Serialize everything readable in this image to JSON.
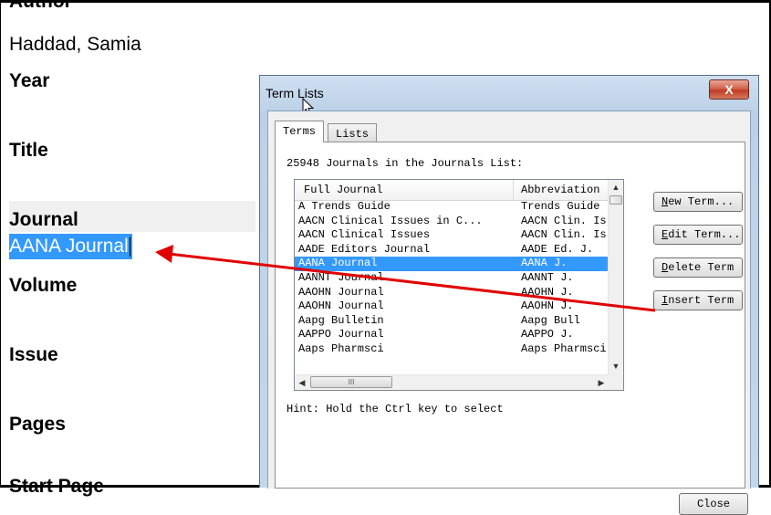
{
  "reference": {
    "author_label": "Author",
    "author_value": "Haddad, Samia",
    "year_label": "Year",
    "title_label": "Title",
    "journal_label": "Journal",
    "journal_value": "AANA Journal",
    "volume_label": "Volume",
    "issue_label": "Issue",
    "pages_label": "Pages",
    "start_page_label": "Start Page"
  },
  "dialog": {
    "title": "Term Lists",
    "close_x": "X",
    "tabs": [
      "Terms",
      "Lists"
    ],
    "count_text": "25948 Journals in the Journals List:",
    "columns": [
      "Full Journal",
      "Abbreviation"
    ],
    "rows": [
      {
        "full": "A Trends Guide",
        "abbr": "Trends Guide"
      },
      {
        "full": "AACN Clinical Issues in C...",
        "abbr": "AACN Clin. Is"
      },
      {
        "full": "AACN Clinical Issues",
        "abbr": "AACN Clin. Is"
      },
      {
        "full": "AADE Editors Journal",
        "abbr": "AADE Ed. J."
      },
      {
        "full": "AANA Journal",
        "abbr": "AANA J.",
        "selected": true
      },
      {
        "full": "AANNT Journal",
        "abbr": "AANNT J."
      },
      {
        "full": "AAOHN Journal",
        "abbr": "AAOHN J."
      },
      {
        "full": "AAOHN Journal",
        "abbr": "AAOHN J."
      },
      {
        "full": "Aapg Bulletin",
        "abbr": "Aapg Bull"
      },
      {
        "full": "AAPPO Journal",
        "abbr": "AAPPO J."
      },
      {
        "full": "Aaps Pharmsci",
        "abbr": "Aaps Pharmsci"
      }
    ],
    "buttons": {
      "new_term": {
        "mnemonic": "N",
        "rest": "ew Term..."
      },
      "edit_term": {
        "mnemonic": "E",
        "rest": "dit Term..."
      },
      "delete_term": {
        "mnemonic": "D",
        "rest": "elete Term"
      },
      "insert_term": {
        "mnemonic": "I",
        "rest": "nsert Term"
      }
    },
    "hscroll_grip": "III",
    "hint": "Hint: Hold the Ctrl key to select",
    "close_label": "Close"
  },
  "colors": {
    "selection": "#3399ff",
    "arrow": "#e00000"
  }
}
